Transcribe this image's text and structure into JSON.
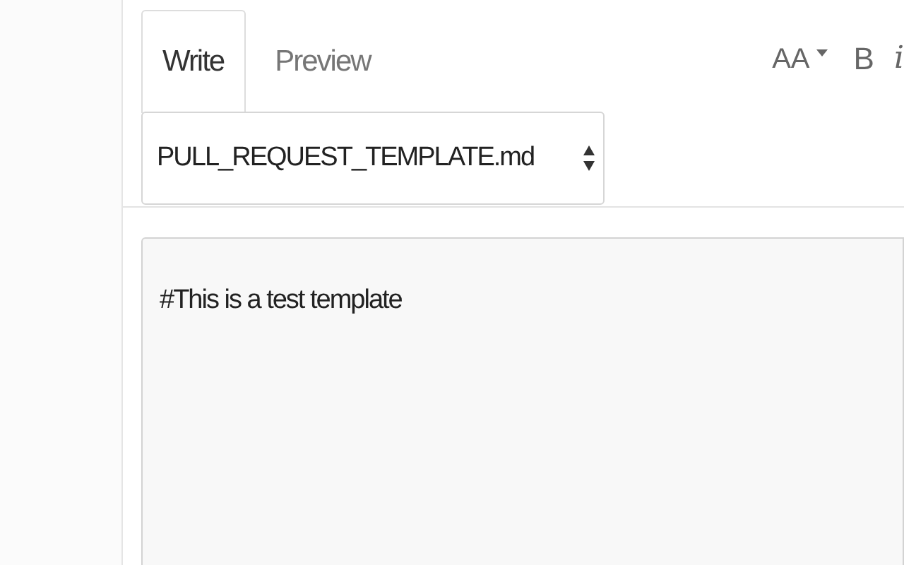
{
  "tabs": [
    {
      "label": "Write",
      "selected": true
    },
    {
      "label": "Preview",
      "selected": false
    }
  ],
  "toolbar": [
    {
      "kind": "text-size",
      "label": "AA"
    },
    {
      "kind": "bold",
      "label": "B"
    },
    {
      "kind": "italic",
      "label": "i"
    }
  ],
  "template_select": {
    "value": "PULL_REQUEST_TEMPLATE.md"
  },
  "editor": {
    "value": "#This is a test template"
  }
}
